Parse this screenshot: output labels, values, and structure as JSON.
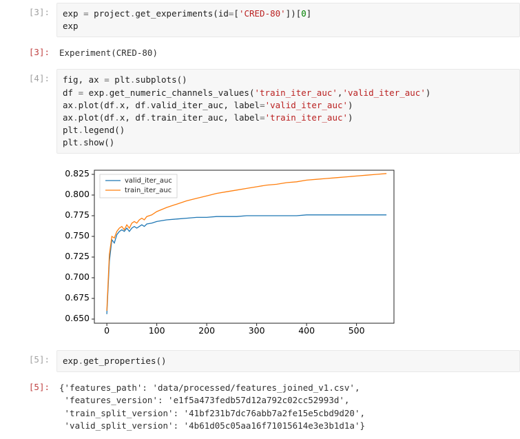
{
  "cells": {
    "c3in": {
      "prompt": "[3]:",
      "code_html": "<span class='n'>exp</span> <span class='o'>=</span> <span class='n'>project</span><span class='o'>.</span><span class='n'>get_experiments</span><span class='p'>(</span><span class='n'>id</span><span class='o'>=</span><span class='p'>[</span><span class='s'>'CRED-80'</span><span class='p'>])[</span><span class='mi'>0</span><span class='p'>]</span>\n<span class='n'>exp</span>"
    },
    "c3out": {
      "prompt": "[3]:",
      "text": "Experiment(CRED-80)"
    },
    "c4in": {
      "prompt": "[4]:",
      "code_html": "<span class='n'>fig</span><span class='p'>,</span> <span class='n'>ax</span> <span class='o'>=</span> <span class='n'>plt</span><span class='o'>.</span><span class='n'>subplots</span><span class='p'>()</span>\n<span class='n'>df</span> <span class='o'>=</span> <span class='n'>exp</span><span class='o'>.</span><span class='n'>get_numeric_channels_values</span><span class='p'>(</span><span class='s'>'train_iter_auc'</span><span class='p'>,</span><span class='s'>'valid_iter_auc'</span><span class='p'>)</span>\n<span class='n'>ax</span><span class='o'>.</span><span class='n'>plot</span><span class='p'>(</span><span class='n'>df</span><span class='o'>.</span><span class='n'>x</span><span class='p'>,</span> <span class='n'>df</span><span class='o'>.</span><span class='n'>valid_iter_auc</span><span class='p'>,</span> <span class='n'>label</span><span class='o'>=</span><span class='s'>'valid_iter_auc'</span><span class='p'>)</span>\n<span class='n'>ax</span><span class='o'>.</span><span class='n'>plot</span><span class='p'>(</span><span class='n'>df</span><span class='o'>.</span><span class='n'>x</span><span class='p'>,</span> <span class='n'>df</span><span class='o'>.</span><span class='n'>train_iter_auc</span><span class='p'>,</span> <span class='n'>label</span><span class='o'>=</span><span class='s'>'train_iter_auc'</span><span class='p'>)</span>\n<span class='n'>plt</span><span class='o'>.</span><span class='n'>legend</span><span class='p'>()</span>\n<span class='n'>plt</span><span class='o'>.</span><span class='n'>show</span><span class='p'>()</span>"
    },
    "c5in": {
      "prompt": "[5]:",
      "code_html": "<span class='n'>exp</span><span class='o'>.</span><span class='n'>get_properties</span><span class='p'>()</span>"
    },
    "c5out": {
      "prompt": "[5]:",
      "text": "{'features_path': 'data/processed/features_joined_v1.csv',\n 'features_version': 'e1f5a473fedb57d12a792c02cc52993d',\n 'train_split_version': '41bf231b7dc76abb7a2fe15e5cbd9d20',\n 'valid_split_version': '4b61d05c05aa16f71015614e3e3b1d1a'}"
    }
  },
  "chart_data": {
    "type": "line",
    "title": "",
    "xlabel": "",
    "ylabel": "",
    "xlim": [
      -25,
      575
    ],
    "ylim": [
      0.645,
      0.83
    ],
    "xticks": [
      0,
      100,
      200,
      300,
      400,
      500
    ],
    "yticks": [
      0.65,
      0.675,
      0.7,
      0.725,
      0.75,
      0.775,
      0.8,
      0.825
    ],
    "legend": {
      "position": "upper-left",
      "entries": [
        "valid_iter_auc",
        "train_iter_auc"
      ]
    },
    "x": [
      0,
      5,
      10,
      15,
      20,
      25,
      30,
      35,
      40,
      45,
      50,
      55,
      60,
      65,
      70,
      75,
      80,
      90,
      100,
      120,
      140,
      160,
      180,
      200,
      220,
      240,
      260,
      280,
      300,
      320,
      340,
      360,
      380,
      400,
      420,
      440,
      460,
      480,
      500,
      520,
      540,
      560
    ],
    "series": [
      {
        "name": "valid_iter_auc",
        "color": "#1f77b4",
        "values": [
          0.656,
          0.72,
          0.746,
          0.742,
          0.752,
          0.756,
          0.758,
          0.756,
          0.76,
          0.756,
          0.76,
          0.762,
          0.76,
          0.762,
          0.764,
          0.762,
          0.765,
          0.766,
          0.768,
          0.77,
          0.771,
          0.772,
          0.773,
          0.773,
          0.774,
          0.774,
          0.774,
          0.775,
          0.775,
          0.775,
          0.775,
          0.775,
          0.775,
          0.776,
          0.776,
          0.776,
          0.776,
          0.776,
          0.776,
          0.776,
          0.776,
          0.776
        ]
      },
      {
        "name": "train_iter_auc",
        "color": "#ff7f0e",
        "values": [
          0.66,
          0.728,
          0.75,
          0.748,
          0.756,
          0.76,
          0.762,
          0.758,
          0.764,
          0.76,
          0.766,
          0.768,
          0.766,
          0.77,
          0.772,
          0.77,
          0.774,
          0.776,
          0.78,
          0.785,
          0.789,
          0.793,
          0.796,
          0.799,
          0.802,
          0.804,
          0.806,
          0.808,
          0.81,
          0.812,
          0.813,
          0.815,
          0.816,
          0.818,
          0.819,
          0.82,
          0.821,
          0.822,
          0.823,
          0.824,
          0.825,
          0.826
        ]
      }
    ]
  }
}
